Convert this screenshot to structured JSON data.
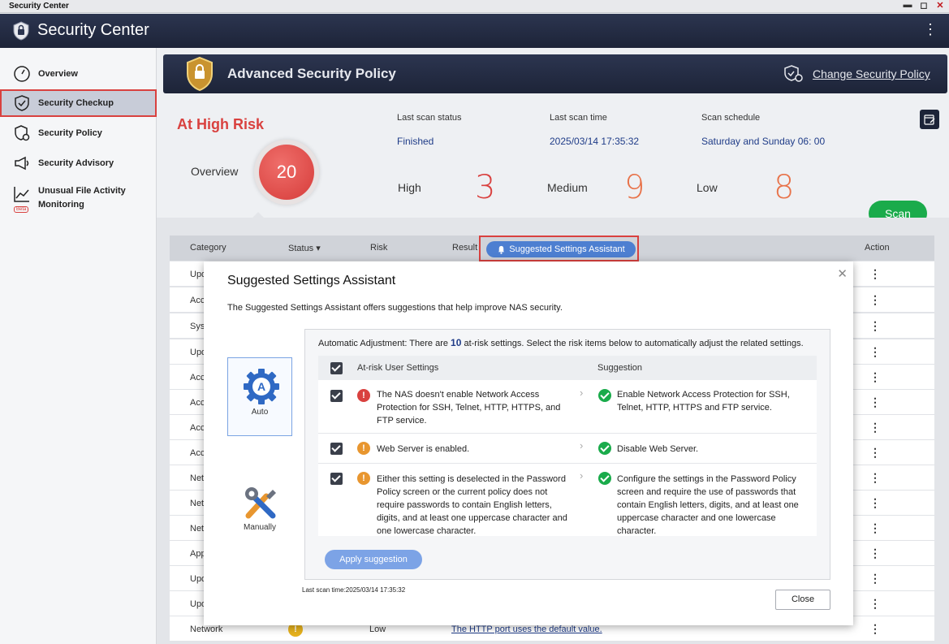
{
  "window": {
    "title": "Security Center"
  },
  "app": {
    "title": "Security Center"
  },
  "sidebar": {
    "items": [
      {
        "label": "Overview",
        "icon": "gauge-icon"
      },
      {
        "label": "Security Checkup",
        "icon": "shield-check-icon",
        "active": true
      },
      {
        "label": "Security Policy",
        "icon": "shield-gear-icon"
      },
      {
        "label": "Security Advisory",
        "icon": "megaphone-icon"
      },
      {
        "label": "Unusual File Activity Monitoring",
        "icon": "trend-line-icon",
        "badge": "Beta"
      }
    ]
  },
  "policy": {
    "title": "Advanced Security Policy",
    "change_label": "Change Security Policy"
  },
  "summary": {
    "risk_label": "At High Risk",
    "overview_label": "Overview",
    "total": "20",
    "last_scan_status_label": "Last scan status",
    "last_scan_status": "Finished",
    "last_scan_time_label": "Last scan time",
    "last_scan_time": "2025/03/14 17:35:32",
    "scan_schedule_label": "Scan schedule",
    "scan_schedule": "Saturday and Sunday 06: 00",
    "high_label": "High",
    "high": "3",
    "medium_label": "Medium",
    "medium": "9",
    "low_label": "Low",
    "low": "8",
    "scan_button": "Scan"
  },
  "table": {
    "headers": {
      "category": "Category",
      "status": "Status ▾",
      "risk": "Risk",
      "result": "Result",
      "action": "Action"
    },
    "assistant_button": "Suggested Settings Assistant",
    "rows": [
      {
        "category": "Upd"
      },
      {
        "category": "Acc"
      },
      {
        "category": "Sys"
      },
      {
        "category": "Upd"
      },
      {
        "category": "Acc"
      },
      {
        "category": "Acc"
      },
      {
        "category": "Acc"
      },
      {
        "category": "Acc"
      },
      {
        "category": "Net"
      },
      {
        "category": "Net"
      },
      {
        "category": "Net"
      },
      {
        "category": "App"
      },
      {
        "category": "Upd"
      },
      {
        "category": "Upd"
      },
      {
        "category": "Network",
        "risk": "Low",
        "result": "The HTTP port uses the default value."
      }
    ]
  },
  "modal": {
    "title": "Suggested Settings Assistant",
    "description": "The Suggested Settings Assistant offers suggestions that help improve NAS security.",
    "mode_auto": "Auto",
    "mode_manual": "Manually",
    "auto_prefix": "Automatic Adjustment: There are ",
    "auto_count": "10",
    "auto_suffix": " at-risk settings. Select the risk items below to automatically adjust the related settings.",
    "col_settings": "At-risk User Settings",
    "col_suggestion": "Suggestion",
    "items": [
      {
        "setting": "The NAS doesn't enable Network Access Protection for SSH, Telnet, HTTP, HTTPS, and FTP service.",
        "suggestion": "Enable Network Access Protection for SSH, Telnet, HTTP, HTTPS and FTP service.",
        "level": "high"
      },
      {
        "setting": "Web Server is enabled.",
        "suggestion": "Disable Web Server.",
        "level": "medium"
      },
      {
        "setting": "Either this setting is deselected in the Password Policy screen or the current policy does not require passwords to contain English letters, digits, and at least one uppercase character and one lowercase character.",
        "suggestion": "Configure the settings in the Password Policy screen and require the use of passwords that contain English letters, digits, and at least one uppercase character and one lowercase character.",
        "level": "medium"
      }
    ],
    "apply_button": "Apply suggestion",
    "last_scan": "Last scan time:2025/03/14 17:35:32",
    "close_button": "Close"
  },
  "colors": {
    "high": "#d9413f",
    "medium": "#e8962f",
    "accent": "#4d7fd1",
    "scan": "#1aab4b"
  }
}
